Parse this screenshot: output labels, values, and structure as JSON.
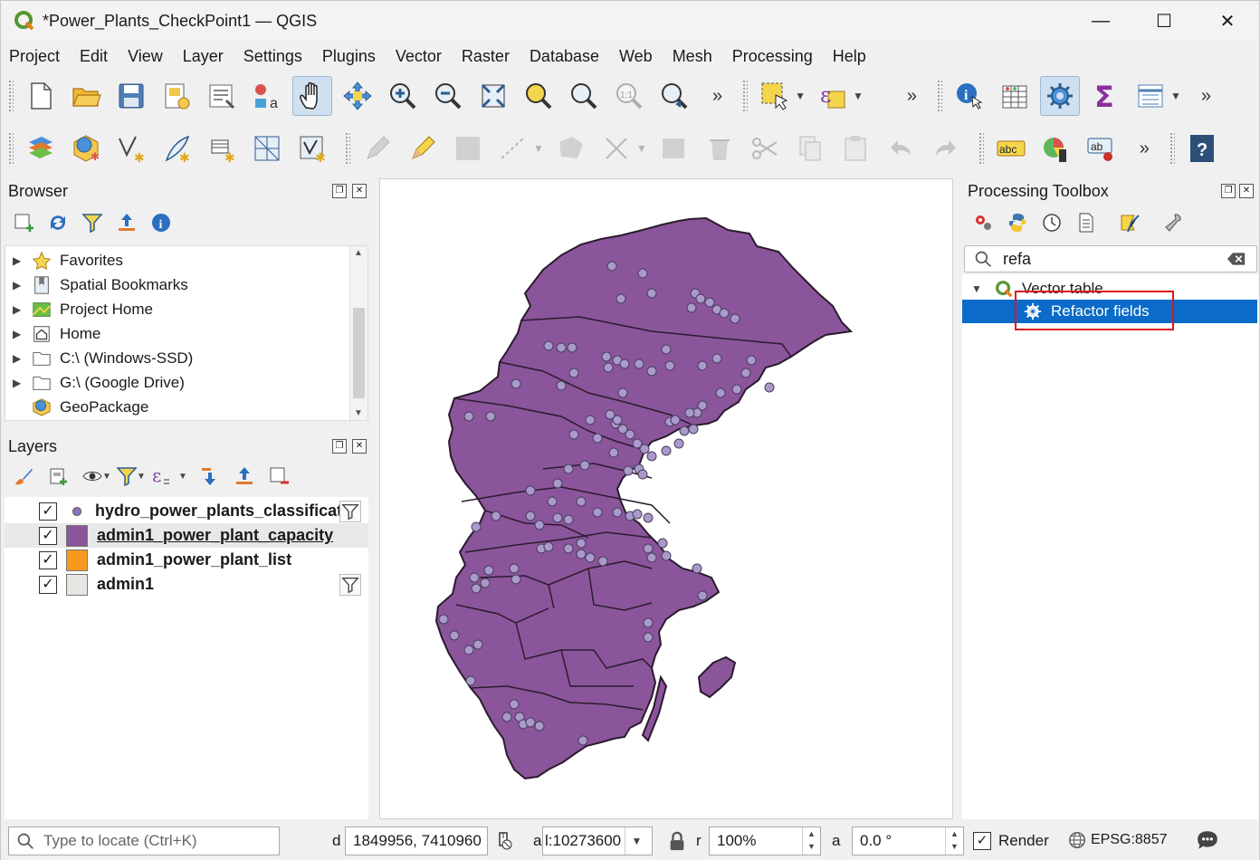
{
  "window": {
    "title": "*Power_Plants_CheckPoint1 — QGIS",
    "minimize": "—",
    "maximize": "☐",
    "close": "✕"
  },
  "menu": [
    "Project",
    "Edit",
    "View",
    "Layer",
    "Settings",
    "Plugins",
    "Vector",
    "Raster",
    "Database",
    "Web",
    "Mesh",
    "Processing",
    "Help"
  ],
  "toolbar": {
    "overflow": "»"
  },
  "browser": {
    "title": "Browser",
    "items": [
      {
        "label": "Favorites",
        "icon": "star-icon"
      },
      {
        "label": "Spatial Bookmarks",
        "icon": "bookmark-icon"
      },
      {
        "label": "Project Home",
        "icon": "project-home-icon"
      },
      {
        "label": "Home",
        "icon": "home-icon"
      },
      {
        "label": "C:\\ (Windows-SSD)",
        "icon": "folder-icon"
      },
      {
        "label": "G:\\ (Google Drive)",
        "icon": "folder-icon"
      },
      {
        "label": "GeoPackage",
        "icon": "geopackage-icon"
      }
    ]
  },
  "layers": {
    "title": "Layers",
    "items": [
      {
        "label": "hydro_power_plants_classificatio",
        "checked": "✓",
        "symbol": "point",
        "color": "#8b72b4",
        "filter": true
      },
      {
        "label": "admin1_power_plant_capacity",
        "checked": "✓",
        "symbol": "polygon",
        "color": "#8b559b",
        "filter": false,
        "selected": true
      },
      {
        "label": "admin1_power_plant_list",
        "checked": "✓",
        "symbol": "polygon",
        "color": "#f59a1c",
        "filter": false
      },
      {
        "label": "admin1",
        "checked": "✓",
        "symbol": "polygon",
        "color": "#e8e6e2",
        "filter": true
      }
    ]
  },
  "toolbox": {
    "title": "Processing Toolbox",
    "search_value": "refa",
    "group": "Vector table",
    "algorithm": "Refactor fields"
  },
  "status": {
    "locate_placeholder": "Type to locate (Ctrl+K)",
    "coord_label": "d",
    "coordinate": "1849956, 7410960",
    "scale_label": "a",
    "scale": "l:10273600",
    "magnifier_label": "r",
    "magnifier": "100%",
    "rotation_label": "a",
    "rotation": "0.0 °",
    "render_checked": "✓",
    "render_label": "Render",
    "crs": "EPSG:8857"
  },
  "colors": {
    "polygon_fill": "#8b559b",
    "polygon_stroke": "#2b1b2e",
    "point_fill": "#a99acb",
    "selection": "#0a6bc8",
    "highlight_box": "#e0161b"
  }
}
